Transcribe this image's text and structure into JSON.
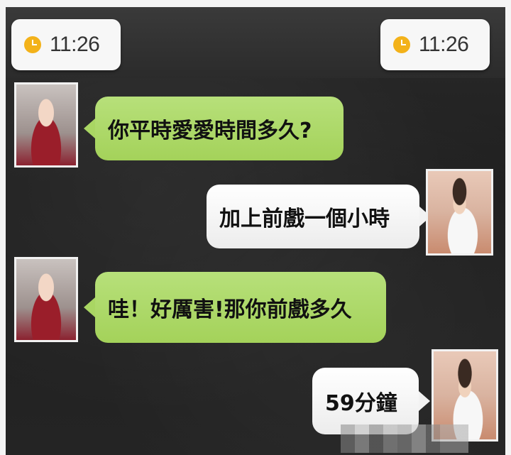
{
  "status_bar": {
    "left_time": "11:26",
    "right_time": "11:26",
    "clock_icon": "clock-icon"
  },
  "messages": [
    {
      "sender": "her",
      "text": "你平時愛愛時間多久?"
    },
    {
      "sender": "him",
      "text": "加上前戲一個小時"
    },
    {
      "sender": "her",
      "text": "哇！好厲害!那你前戲多久"
    },
    {
      "sender": "him",
      "text": "59分鐘"
    }
  ],
  "colors": {
    "her_bubble": "#a9d663",
    "his_bubble": "#f2f2f2",
    "clock": "#f3b21a",
    "background": "#222222"
  }
}
